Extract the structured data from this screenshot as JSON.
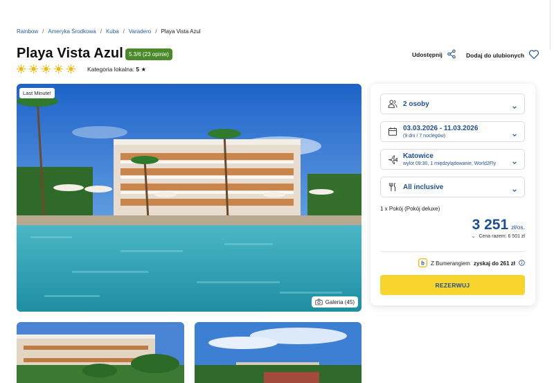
{
  "breadcrumb": {
    "items": [
      "Rainbow",
      "Ameryka Środkowa",
      "Kuba",
      "Varadero"
    ],
    "current": "Playa Vista Azul",
    "separator": "/"
  },
  "hotel": {
    "name": "Playa Vista Azul",
    "rating_badge": "5.3/6 (23 opinie)",
    "star_count": 5,
    "local_category_label": "Kategoria lokalna:",
    "local_category_value": "5"
  },
  "actions": {
    "share_label": "Udostępnij",
    "favorite_label": "Dodaj do ulubionych"
  },
  "gallery": {
    "last_minute_label": "Last Minute!",
    "gallery_label": "Galeria (45)"
  },
  "booking": {
    "persons": "2 osoby",
    "dates": "03.03.2026 - 11.03.2026",
    "dates_sub": "(9 dni / 7 noclegów)",
    "departure": "Katowice",
    "departure_sub": "wylot 09:30, 1 międzylądowanie, World2Fly",
    "board": "All inclusive",
    "room": "1 x Pokój   (Pokój deluxe)",
    "price": "3 251",
    "price_unit": "zł/os.",
    "total": "Cena razem: 6 501 zł",
    "bumerang_prefix": "Z Bumerangiem",
    "bumerang_value": "zyskaj do 261 zł",
    "reserve_label": "REZERWUJ"
  },
  "colors": {
    "brand_blue": "#1d4f91",
    "rating_green": "#4a8a2a",
    "cta_yellow": "#f8d52e",
    "sun_yellow": "#f5b800"
  }
}
